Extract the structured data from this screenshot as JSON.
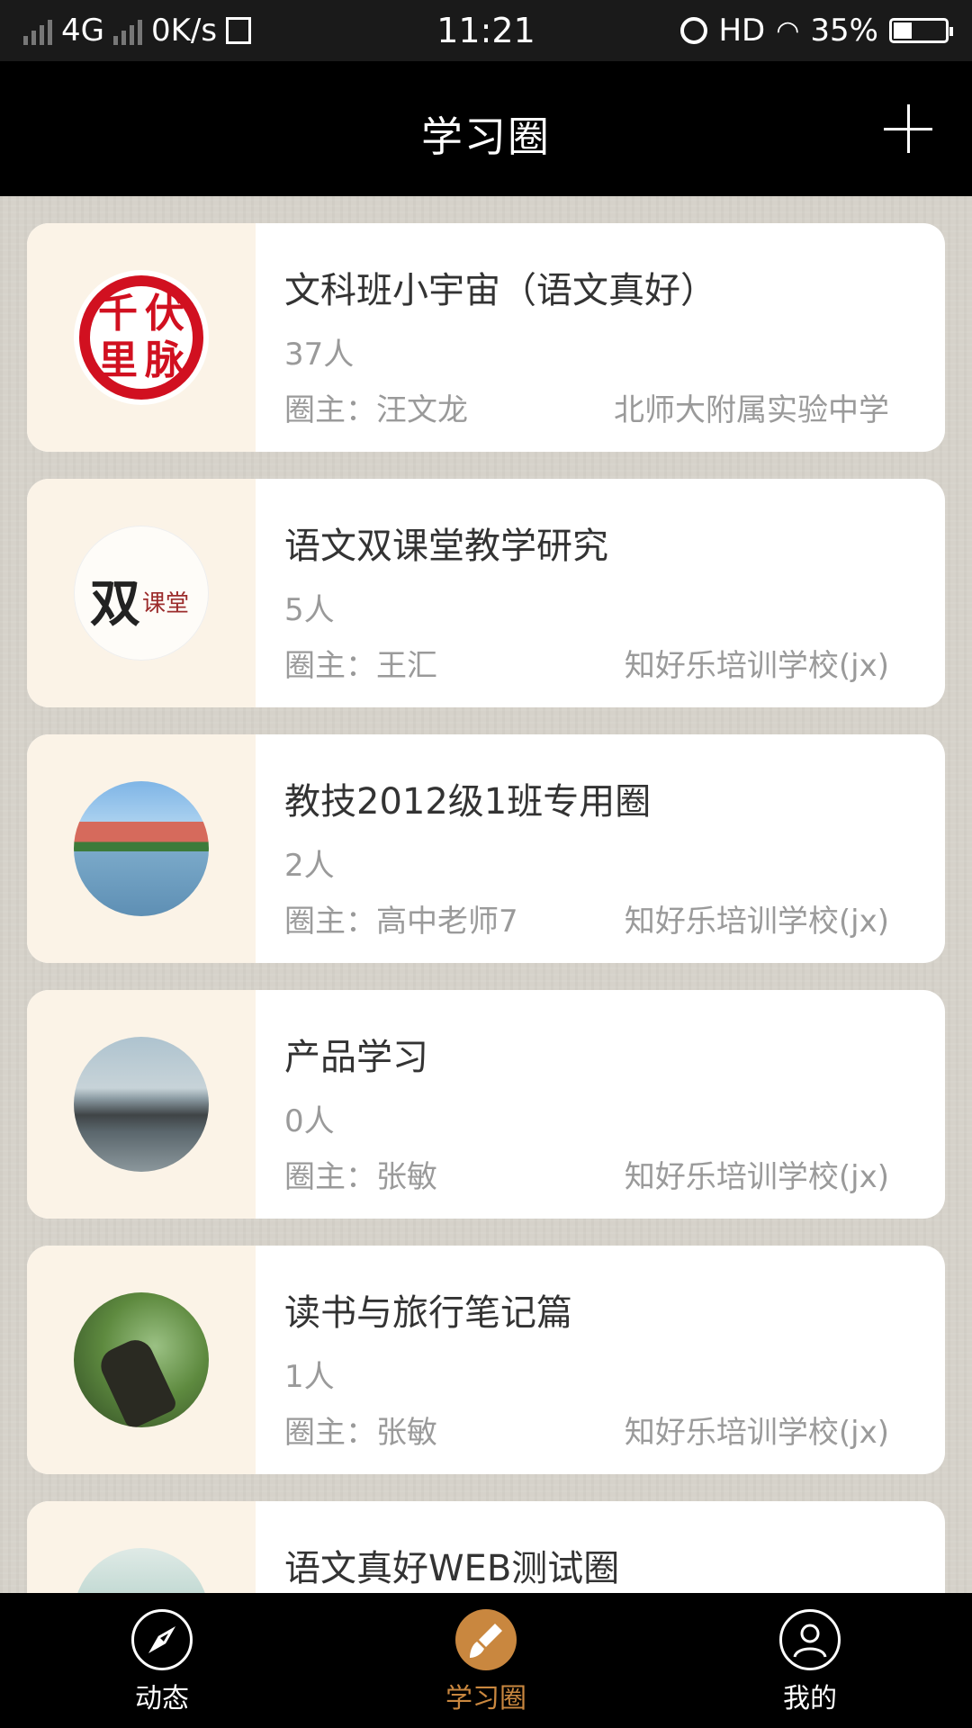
{
  "status_bar": {
    "network": "4G",
    "speed": "0K/s",
    "time": "11:21",
    "hd": "HD",
    "battery": "35%",
    "battery_level": 0.35
  },
  "header": {
    "title": "学习圈"
  },
  "circles": [
    {
      "name": "文科班小宇宙（语文真好）",
      "count": "37人",
      "owner": "圈主：汪文龙",
      "school": "北师大附属实验中学",
      "avatar_icon": "seal-qianli-fumai-avatar",
      "seal_chars": [
        "千",
        "伏",
        "里",
        "脉"
      ]
    },
    {
      "name": "语文双课堂教学研究",
      "count": "5人",
      "owner": "圈主：王汇",
      "school": "知好乐培训学校(jx)",
      "avatar_icon": "shuang-ketang-logo-avatar",
      "logo_big": "双",
      "logo_small": "课堂"
    },
    {
      "name": "教技2012级1班专用圈",
      "count": "2人",
      "owner": "圈主：高中老师7",
      "school": "知好乐培训学校(jx)",
      "avatar_icon": "campus-building-photo-avatar"
    },
    {
      "name": "产品学习",
      "count": "0人",
      "owner": "圈主：张敏",
      "school": "知好乐培训学校(jx)",
      "avatar_icon": "seaside-rocks-photo-avatar"
    },
    {
      "name": "读书与旅行笔记篇",
      "count": "1人",
      "owner": "圈主：张敏",
      "school": "知好乐培训学校(jx)",
      "avatar_icon": "hand-trees-photo-avatar"
    },
    {
      "name": "语文真好WEB测试圈",
      "count": "",
      "owner": "",
      "school": "",
      "avatar_icon": "mountain-painting-avatar"
    }
  ],
  "tabs": [
    {
      "label": "动态",
      "icon": "compass-icon",
      "active": false
    },
    {
      "label": "学习圈",
      "icon": "brush-icon",
      "active": true
    },
    {
      "label": "我的",
      "icon": "user-icon",
      "active": false
    }
  ],
  "colors": {
    "accent": "#c9873f",
    "background": "#d6d2ca",
    "avatar_pane": "#fbf3e7"
  }
}
